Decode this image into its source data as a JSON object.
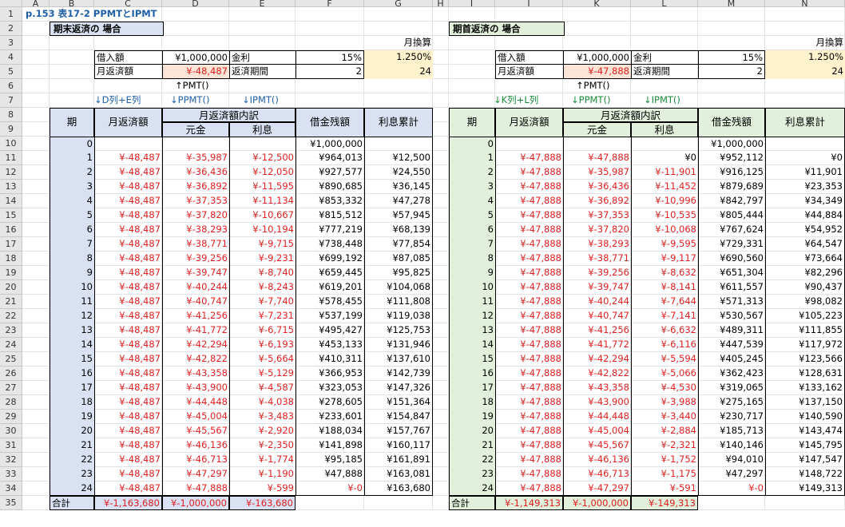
{
  "columns": [
    "A",
    "B",
    "C",
    "D",
    "E",
    "F",
    "G",
    "H",
    "I",
    "J",
    "K",
    "L",
    "M",
    "N"
  ],
  "rows": [
    "1",
    "2",
    "3",
    "4",
    "5",
    "6",
    "7",
    "8",
    "9",
    "10",
    "11",
    "12",
    "13",
    "14",
    "15",
    "16",
    "17",
    "18",
    "19",
    "20",
    "21",
    "22",
    "23",
    "24",
    "25",
    "26",
    "27",
    "28",
    "29",
    "30",
    "31",
    "32",
    "33",
    "34",
    "35"
  ],
  "title": "p.153 表17-2 PPMTとIPMT",
  "left": {
    "heading": "期末返済の 場合",
    "monthly_conv": "月換算",
    "loan_label": "借入額",
    "loan_value": "¥1,000,000",
    "rate_label": "金利",
    "rate_value": "15%",
    "rate_month": "1.250%",
    "pay_label": "月返済額",
    "pay_value": "¥-48,487",
    "period_label": "返済期間",
    "period_value": "2",
    "period_month": "24",
    "pmt_note": "↑PMT()",
    "note_de": "↓D列+E列",
    "note_ppmt": "↓PPMT()",
    "note_ipmt": "↓IPMT()",
    "h_period": "期",
    "h_pay": "月返済額",
    "h_breakdown": "月返済額内訳",
    "h_principal": "元金",
    "h_interest": "利息",
    "h_balance": "借金残額",
    "h_cum": "利息累計",
    "row0_balance": "¥1,000,000",
    "rows": [
      [
        "1",
        "¥-48,487",
        "¥-35,987",
        "¥-12,500",
        "¥964,013",
        "¥12,500"
      ],
      [
        "2",
        "¥-48,487",
        "¥-36,436",
        "¥-12,050",
        "¥927,577",
        "¥24,550"
      ],
      [
        "3",
        "¥-48,487",
        "¥-36,892",
        "¥-11,595",
        "¥890,685",
        "¥36,145"
      ],
      [
        "4",
        "¥-48,487",
        "¥-37,353",
        "¥-11,134",
        "¥853,332",
        "¥47,278"
      ],
      [
        "5",
        "¥-48,487",
        "¥-37,820",
        "¥-10,667",
        "¥815,512",
        "¥57,945"
      ],
      [
        "6",
        "¥-48,487",
        "¥-38,293",
        "¥-10,194",
        "¥777,219",
        "¥68,139"
      ],
      [
        "7",
        "¥-48,487",
        "¥-38,771",
        "¥-9,715",
        "¥738,448",
        "¥77,854"
      ],
      [
        "8",
        "¥-48,487",
        "¥-39,256",
        "¥-9,231",
        "¥699,192",
        "¥87,085"
      ],
      [
        "9",
        "¥-48,487",
        "¥-39,747",
        "¥-8,740",
        "¥659,445",
        "¥95,825"
      ],
      [
        "10",
        "¥-48,487",
        "¥-40,244",
        "¥-8,243",
        "¥619,201",
        "¥104,068"
      ],
      [
        "11",
        "¥-48,487",
        "¥-40,747",
        "¥-7,740",
        "¥578,455",
        "¥111,808"
      ],
      [
        "12",
        "¥-48,487",
        "¥-41,256",
        "¥-7,231",
        "¥537,199",
        "¥119,038"
      ],
      [
        "13",
        "¥-48,487",
        "¥-41,772",
        "¥-6,715",
        "¥495,427",
        "¥125,753"
      ],
      [
        "14",
        "¥-48,487",
        "¥-42,294",
        "¥-6,193",
        "¥453,133",
        "¥131,946"
      ],
      [
        "15",
        "¥-48,487",
        "¥-42,822",
        "¥-5,664",
        "¥410,311",
        "¥137,610"
      ],
      [
        "16",
        "¥-48,487",
        "¥-43,358",
        "¥-5,129",
        "¥366,953",
        "¥142,739"
      ],
      [
        "17",
        "¥-48,487",
        "¥-43,900",
        "¥-4,587",
        "¥323,053",
        "¥147,326"
      ],
      [
        "18",
        "¥-48,487",
        "¥-44,448",
        "¥-4,038",
        "¥278,605",
        "¥151,364"
      ],
      [
        "19",
        "¥-48,487",
        "¥-45,004",
        "¥-3,483",
        "¥233,601",
        "¥154,847"
      ],
      [
        "20",
        "¥-48,487",
        "¥-45,567",
        "¥-2,920",
        "¥188,034",
        "¥157,767"
      ],
      [
        "21",
        "¥-48,487",
        "¥-46,136",
        "¥-2,350",
        "¥141,898",
        "¥160,117"
      ],
      [
        "22",
        "¥-48,487",
        "¥-46,713",
        "¥-1,774",
        "¥95,185",
        "¥161,891"
      ],
      [
        "23",
        "¥-48,487",
        "¥-47,297",
        "¥-1,190",
        "¥47,888",
        "¥163,081"
      ],
      [
        "24",
        "¥-48,487",
        "¥-47,888",
        "¥-599",
        "¥-0",
        "¥163,680"
      ]
    ],
    "total_label": "合計",
    "total_pay": "¥-1,163,680",
    "total_principal": "¥-1,000,000",
    "total_interest": "¥-163,680"
  },
  "right": {
    "heading": "期首返済の 場合",
    "monthly_conv": "月換算",
    "loan_label": "借入額",
    "loan_value": "¥1,000,000",
    "rate_label": "金利",
    "rate_value": "15%",
    "rate_month": "1.250%",
    "pay_label": "月返済額",
    "pay_value": "¥-47,888",
    "period_label": "返済期間",
    "period_value": "2",
    "period_month": "24",
    "pmt_note": "↑PMT()",
    "note_kl": "↓K列+L列",
    "note_ppmt": "↓PPMT()",
    "note_ipmt": "↓IPMT()",
    "h_period": "期",
    "h_pay": "月返済額",
    "h_breakdown": "月返済額内訳",
    "h_principal": "元金",
    "h_interest": "利息",
    "h_balance": "借金残額",
    "h_cum": "利息累計",
    "row0_balance": "¥1,000,000",
    "rows": [
      [
        "1",
        "¥-47,888",
        "¥-47,888",
        "¥0",
        "¥952,112",
        "¥0"
      ],
      [
        "2",
        "¥-47,888",
        "¥-35,987",
        "¥-11,901",
        "¥916,125",
        "¥11,901"
      ],
      [
        "3",
        "¥-47,888",
        "¥-36,436",
        "¥-11,452",
        "¥879,689",
        "¥23,353"
      ],
      [
        "4",
        "¥-47,888",
        "¥-36,892",
        "¥-10,996",
        "¥842,797",
        "¥34,349"
      ],
      [
        "5",
        "¥-47,888",
        "¥-37,353",
        "¥-10,535",
        "¥805,444",
        "¥44,884"
      ],
      [
        "6",
        "¥-47,888",
        "¥-37,820",
        "¥-10,068",
        "¥767,624",
        "¥54,952"
      ],
      [
        "7",
        "¥-47,888",
        "¥-38,293",
        "¥-9,595",
        "¥729,331",
        "¥64,547"
      ],
      [
        "8",
        "¥-47,888",
        "¥-38,771",
        "¥-9,117",
        "¥690,560",
        "¥73,664"
      ],
      [
        "9",
        "¥-47,888",
        "¥-39,256",
        "¥-8,632",
        "¥651,304",
        "¥82,296"
      ],
      [
        "10",
        "¥-47,888",
        "¥-39,747",
        "¥-8,141",
        "¥611,557",
        "¥90,437"
      ],
      [
        "11",
        "¥-47,888",
        "¥-40,244",
        "¥-7,644",
        "¥571,313",
        "¥98,082"
      ],
      [
        "12",
        "¥-47,888",
        "¥-40,747",
        "¥-7,141",
        "¥530,567",
        "¥105,223"
      ],
      [
        "13",
        "¥-47,888",
        "¥-41,256",
        "¥-6,632",
        "¥489,311",
        "¥111,855"
      ],
      [
        "14",
        "¥-47,888",
        "¥-41,772",
        "¥-6,116",
        "¥447,539",
        "¥117,972"
      ],
      [
        "15",
        "¥-47,888",
        "¥-42,294",
        "¥-5,594",
        "¥405,245",
        "¥123,566"
      ],
      [
        "16",
        "¥-47,888",
        "¥-42,822",
        "¥-5,066",
        "¥362,423",
        "¥128,631"
      ],
      [
        "17",
        "¥-47,888",
        "¥-43,358",
        "¥-4,530",
        "¥319,065",
        "¥133,162"
      ],
      [
        "18",
        "¥-47,888",
        "¥-43,900",
        "¥-3,988",
        "¥275,165",
        "¥137,150"
      ],
      [
        "19",
        "¥-47,888",
        "¥-44,448",
        "¥-3,440",
        "¥230,717",
        "¥140,590"
      ],
      [
        "20",
        "¥-47,888",
        "¥-45,004",
        "¥-2,884",
        "¥185,713",
        "¥143,474"
      ],
      [
        "21",
        "¥-47,888",
        "¥-45,567",
        "¥-2,321",
        "¥140,146",
        "¥145,795"
      ],
      [
        "22",
        "¥-47,888",
        "¥-46,136",
        "¥-1,752",
        "¥94,010",
        "¥147,547"
      ],
      [
        "23",
        "¥-47,888",
        "¥-46,713",
        "¥-1,175",
        "¥47,297",
        "¥148,722"
      ],
      [
        "24",
        "¥-47,888",
        "¥-47,297",
        "¥-591",
        "¥-0",
        "¥149,313"
      ]
    ],
    "total_label": "合計",
    "total_pay": "¥-1,149,313",
    "total_principal": "¥-1,000,000",
    "total_interest": "¥-149,313"
  },
  "colors": {
    "left_header": "#d9e1f2",
    "right_header": "#e2efda",
    "highlight": "#fce4d6",
    "monthly": "#fff2cc",
    "red": "#e02020",
    "blue": "#1f5fa8",
    "green": "#1a8a3a"
  }
}
